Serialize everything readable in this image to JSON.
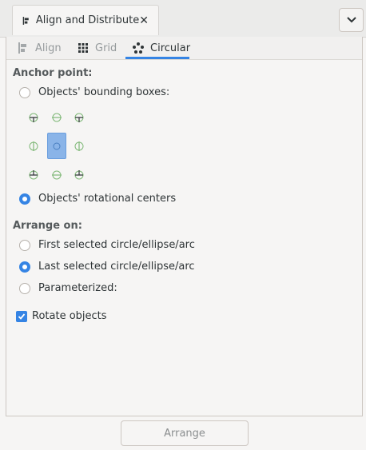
{
  "header": {
    "tab_title": "Align and Distribute",
    "tab_icon": "align-icon",
    "close_icon": "close-icon",
    "menu_icon": "chevron-down-icon"
  },
  "subtabs": [
    {
      "label": "Align",
      "icon": "align-icon",
      "active": false
    },
    {
      "label": "Grid",
      "icon": "grid-icon",
      "active": false
    },
    {
      "label": "Circular",
      "icon": "circular-icon",
      "active": true
    }
  ],
  "anchor": {
    "title": "Anchor point:",
    "bounding_boxes_label": "Objects' bounding boxes:",
    "bounding_boxes_checked": false,
    "rotational_centers_label": "Objects' rotational centers",
    "rotational_centers_checked": true
  },
  "arrange_on": {
    "title": "Arrange on:",
    "options": [
      {
        "label": "First selected circle/ellipse/arc",
        "checked": false
      },
      {
        "label": "Last selected circle/ellipse/arc",
        "checked": true
      },
      {
        "label": "Parameterized:",
        "checked": false
      }
    ]
  },
  "rotate_objects": {
    "label": "Rotate objects",
    "checked": true
  },
  "arrange_button": {
    "label": "Arrange",
    "enabled": false
  },
  "colors": {
    "accent": "#3584e4",
    "anchor_green": "#4e9a06",
    "anchor_selected": "#8ab4e8"
  }
}
